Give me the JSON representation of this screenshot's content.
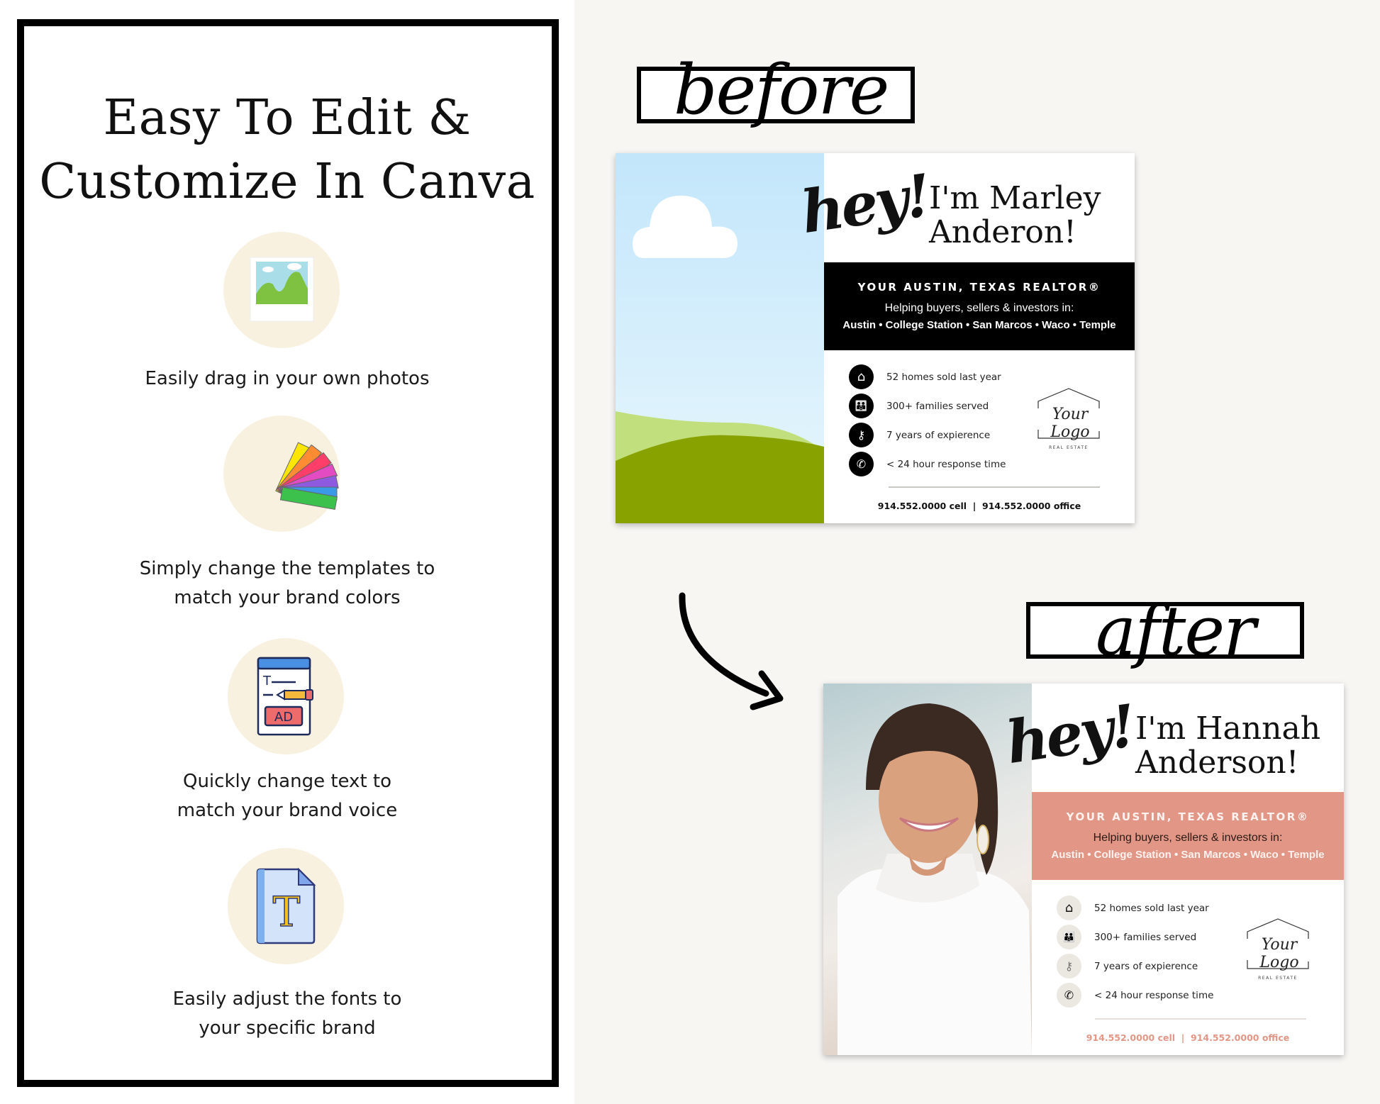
{
  "headline": [
    "Easy To Edit &",
    "Customize In Canva"
  ],
  "features": [
    {
      "icon": "photo-icon",
      "lines": [
        "Easily drag in your own photos"
      ]
    },
    {
      "icon": "color-swatch-icon",
      "lines": [
        "Simply change the templates to",
        "match your brand colors"
      ]
    },
    {
      "icon": "text-edit-ad-icon",
      "lines": [
        "Quickly change text to",
        "match your brand voice"
      ]
    },
    {
      "icon": "font-file-icon",
      "lines": [
        "Easily adjust the fonts to",
        "your specific brand"
      ]
    }
  ],
  "before": {
    "label": "before",
    "card": {
      "hey": "hey!",
      "name_lines": [
        "I'm Marley",
        "Anderon!"
      ],
      "band_title": "YOUR AUSTIN, TEXAS REALTOR®",
      "band_sub": "Helping buyers, sellers & investors in:",
      "band_cities": "Austin • College Station • San Marcos • Waco • Temple",
      "stats": [
        {
          "icon": "house-icon",
          "text": "52 homes sold last year"
        },
        {
          "icon": "family-icon",
          "text": "300+ families served"
        },
        {
          "icon": "key-icon",
          "text": "7 years of expierence"
        },
        {
          "icon": "whatsapp-icon",
          "text": "< 24 hour response time"
        }
      ],
      "logo_script": "Your Logo",
      "logo_sub": "REAL ESTATE",
      "phone": "914.552.0000 cell  |  914.552.0000 office",
      "accent": "#000000"
    }
  },
  "after": {
    "label": "after",
    "card": {
      "hey": "hey!",
      "name_lines": [
        "I'm Hannah",
        "Anderson!"
      ],
      "band_title": "YOUR AUSTIN, TEXAS REALTOR®",
      "band_sub": "Helping buyers, sellers & investors in:",
      "band_cities": "Austin • College Station • San Marcos • Waco • Temple",
      "stats": [
        {
          "icon": "house-icon",
          "text": "52 homes sold last year"
        },
        {
          "icon": "family-icon",
          "text": "300+ families served"
        },
        {
          "icon": "key-icon",
          "text": "7 years of expierence"
        },
        {
          "icon": "whatsapp-icon",
          "text": "< 24 hour response time"
        }
      ],
      "logo_script": "Your Logo",
      "logo_sub": "REAL ESTATE",
      "phone": "914.552.0000 cell  |  914.552.0000 office",
      "accent": "#e29686"
    }
  }
}
